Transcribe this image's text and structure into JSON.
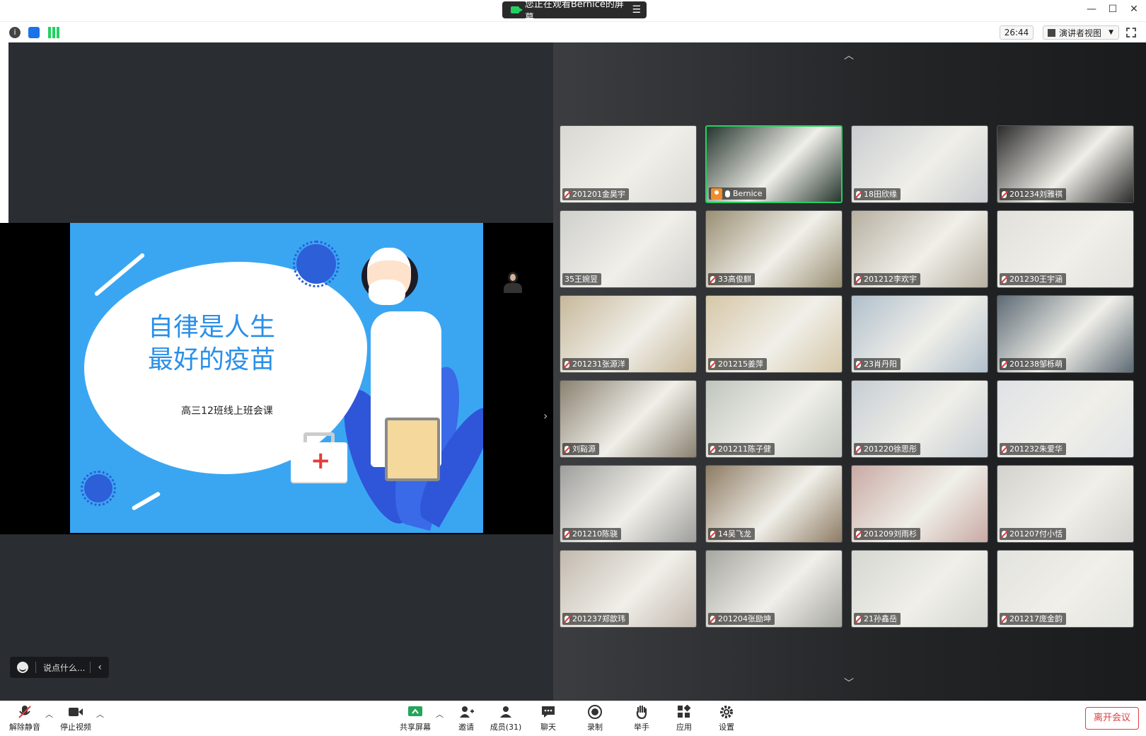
{
  "title_bar": {
    "share_notice": "您正在观看Bernice的屏幕",
    "minimize_icon": "minimize-icon",
    "maximize_icon": "maximize-icon",
    "close_icon": "close-icon"
  },
  "toolbar2": {
    "timer": "26:44",
    "view_label": "演讲者视图"
  },
  "slide": {
    "title_line1": "自律是人生",
    "title_line2": "最好的疫苗",
    "subtitle": "高三12班线上班会课"
  },
  "chat_bar": {
    "placeholder": "说点什么..."
  },
  "participants": [
    {
      "name": "201201金昊宇",
      "muted": true,
      "bg": "#d9d8d2"
    },
    {
      "name": "Bernice",
      "muted": false,
      "host": true,
      "bg": "#26362e"
    },
    {
      "name": "18田欣缘",
      "muted": true,
      "bg": "#c9cdd0"
    },
    {
      "name": "201234刘雅祺",
      "muted": true,
      "bg": "#2b2b2b"
    },
    {
      "name": "35王婉昱",
      "muted": false,
      "bg": "#cfcfcc"
    },
    {
      "name": "33高俊麒",
      "muted": true,
      "bg": "#9a8f74"
    },
    {
      "name": "201212李欢宇",
      "muted": true,
      "bg": "#b7b0a2"
    },
    {
      "name": "201230王宇涵",
      "muted": true,
      "bg": "#e1e0dc"
    },
    {
      "name": "201231张源洋",
      "muted": true,
      "bg": "#c7b89a"
    },
    {
      "name": "201215姜萍",
      "muted": true,
      "bg": "#d6c7a8"
    },
    {
      "name": "23肖丹阳",
      "muted": true,
      "bg": "#b0bfcc"
    },
    {
      "name": "201238邹栎萌",
      "muted": true,
      "bg": "#5d6a74"
    },
    {
      "name": "刘谿源",
      "muted": true,
      "bg": "#8a8170"
    },
    {
      "name": "201211陈子健",
      "muted": true,
      "bg": "#bfc6be"
    },
    {
      "name": "201220徐思彤",
      "muted": true,
      "bg": "#c6cdd3"
    },
    {
      "name": "201232朱爱华",
      "muted": true,
      "bg": "#dfe2e6"
    },
    {
      "name": "201210陈骁",
      "muted": true,
      "bg": "#9e9e9c"
    },
    {
      "name": "14吴飞龙",
      "muted": true,
      "bg": "#8e7c64"
    },
    {
      "name": "201209刘雨杉",
      "muted": true,
      "bg": "#c9aaa4"
    },
    {
      "name": "201207付小恬",
      "muted": true,
      "bg": "#d3d2ce"
    },
    {
      "name": "201237郑歆玮",
      "muted": true,
      "bg": "#c2b9ae"
    },
    {
      "name": "201204张励坤",
      "muted": true,
      "bg": "#a7a7a2"
    },
    {
      "name": "21孙鑫岳",
      "muted": true,
      "bg": "#d6d7d2"
    },
    {
      "name": "201217庞金韵",
      "muted": true,
      "bg": "#e3e3df"
    }
  ],
  "bottom_bar": {
    "unmute": "解除静音",
    "stop_video": "停止视频",
    "share_screen": "共享屏幕",
    "invite": "邀请",
    "members": "成员(31)",
    "chat": "聊天",
    "record": "录制",
    "raise_hand": "举手",
    "apps": "应用",
    "settings": "设置",
    "leave": "离开会议"
  },
  "colors": {
    "accent_green": "#23d160",
    "leave_red": "#e23c3c",
    "slide_blue": "#3aa6f2"
  }
}
